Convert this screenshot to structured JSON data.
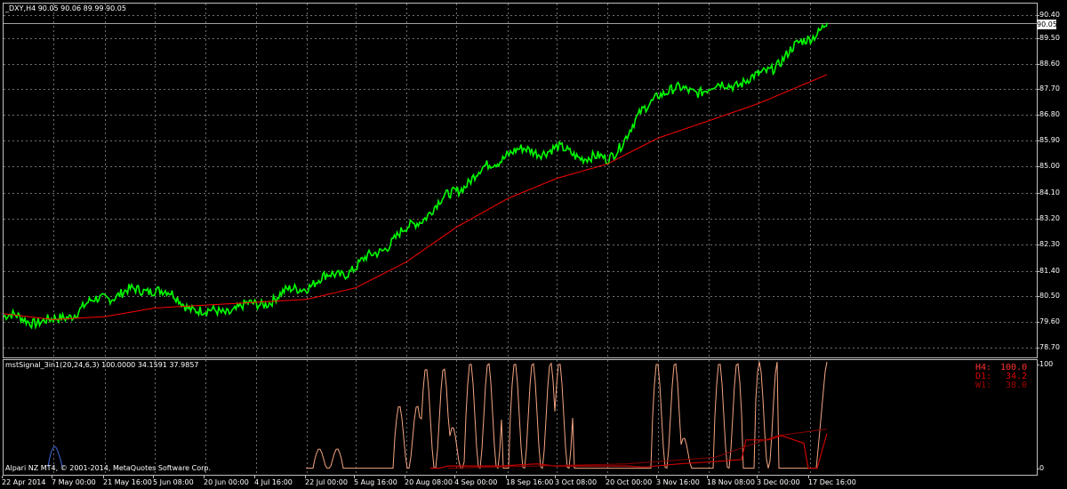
{
  "main_chart": {
    "title": "_DXY,H4  90.05 90.06 89.99 90.05",
    "current_price": "90.05",
    "y_labels": [
      "90.40",
      "89.50",
      "88.60",
      "87.70",
      "86.80",
      "85.90",
      "85.00",
      "84.10",
      "83.20",
      "82.30",
      "81.40",
      "80.50",
      "79.60",
      "78.70"
    ],
    "colors": {
      "price": "#00ff00",
      "ma": "#ff0000",
      "grid": "#707070",
      "frame": "#c0c0c0"
    }
  },
  "indicator": {
    "title": "mstSignal_3in1(20,24,6,3) 100.0000 34.1591 37.9857",
    "y_labels": [
      "100",
      "0"
    ],
    "readouts": [
      {
        "label": "H4:",
        "value": "100.0",
        "color": "#ff3030"
      },
      {
        "label": "D1:",
        "value": "34.2",
        "color": "#ff1010"
      },
      {
        "label": "W1:",
        "value": "38.0",
        "color": "#b00000"
      }
    ],
    "colors": {
      "h4": "#f4a582",
      "d1": "#cc0000",
      "w1": "#8b0000",
      "blue": "#4169e1"
    }
  },
  "copyright": "Alpari NZ MT4, © 2001-2014, MetaQuotes Software Corp.",
  "x_labels": [
    "22 Apr 2014",
    "7 May 00:00",
    "21 May 16:00",
    "5 Jun 08:00",
    "20 Jun 00:00",
    "4 Jul 16:00",
    "22 Jul 00:00",
    "5 Aug 16:00",
    "20 Aug 08:00",
    "4 Sep 00:00",
    "18 Sep 16:00",
    "3 Oct 08:00",
    "20 Oct 00:00",
    "3 Nov 16:00",
    "18 Nov 08:00",
    "3 Dec 00:00",
    "17 Dec 16:00"
  ],
  "chart_data": {
    "type": "line",
    "title": "_DXY,H4",
    "x": [
      "22 Apr 2014",
      "7 May 00:00",
      "21 May 16:00",
      "5 Jun 08:00",
      "20 Jun 00:00",
      "4 Jul 16:00",
      "22 Jul 00:00",
      "5 Aug 16:00",
      "20 Aug 08:00",
      "4 Sep 00:00",
      "18 Sep 16:00",
      "3 Oct 08:00",
      "20 Oct 00:00",
      "3 Nov 16:00",
      "18 Nov 08:00",
      "3 Dec 00:00",
      "17 Dec 16:00"
    ],
    "ylim": [
      78.7,
      90.4
    ],
    "grid": true,
    "series": [
      {
        "values": [
          79.9,
          79.7,
          80.6,
          80.9,
          80.0,
          80.3,
          81.0,
          81.6,
          82.9,
          84.3,
          85.6,
          85.7,
          85.3,
          87.7,
          87.8,
          88.2,
          90.1
        ]
      },
      {
        "values": [
          80.0,
          79.8,
          79.9,
          80.2,
          80.3,
          80.4,
          80.5,
          80.9,
          81.8,
          83.0,
          84.0,
          84.7,
          85.2,
          86.1,
          86.7,
          87.3,
          88.3
        ]
      }
    ]
  }
}
